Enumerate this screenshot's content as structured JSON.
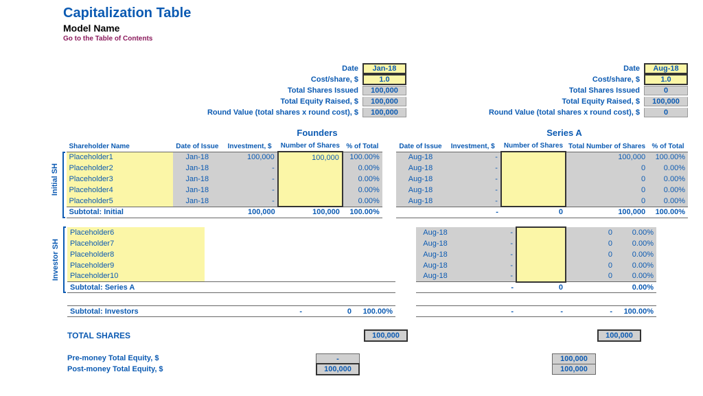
{
  "header": {
    "title": "Capitalization Table",
    "subtitle": "Model Name",
    "toc_link": "Go to the Table of Contents"
  },
  "summary": {
    "labels": {
      "date": "Date",
      "cost": "Cost/share, $",
      "shares": "Total Shares Issued",
      "equity": "Total Equity Raised, $",
      "round": "Round Value (total shares x round cost), $"
    },
    "founders": {
      "date": "Jan-18",
      "cost": "1.0",
      "shares": "100,000",
      "equity": "100,000",
      "round": "100,000"
    },
    "seriesA": {
      "date": "Aug-18",
      "cost": "1.0",
      "shares": "0",
      "equity": "100,000",
      "round": "0"
    }
  },
  "rounds": {
    "founders": "Founders",
    "seriesA": "Series A"
  },
  "cols": {
    "shareholder": "Shareholder Name",
    "date": "Date of Issue",
    "inv": "Investment, $",
    "num": "Number of Shares",
    "pct": "% of Total",
    "tot_num": "Total Number of Shares"
  },
  "groups": {
    "initial": "Initial SH",
    "investor": "Investor SH"
  },
  "initial_rows": [
    {
      "name": "Placeholder1",
      "fd": "Jan-18",
      "finv": "100,000",
      "fnum": "100,000",
      "fpct": "100.00%",
      "sd": "Aug-18",
      "sinv": "-",
      "snum": "",
      "stot": "100,000",
      "spct": "100.00%"
    },
    {
      "name": "Placeholder2",
      "fd": "Jan-18",
      "finv": "-",
      "fnum": "",
      "fpct": "0.00%",
      "sd": "Aug-18",
      "sinv": "-",
      "snum": "",
      "stot": "0",
      "spct": "0.00%"
    },
    {
      "name": "Placeholder3",
      "fd": "Jan-18",
      "finv": "-",
      "fnum": "",
      "fpct": "0.00%",
      "sd": "Aug-18",
      "sinv": "-",
      "snum": "",
      "stot": "0",
      "spct": "0.00%"
    },
    {
      "name": "Placeholder4",
      "fd": "Jan-18",
      "finv": "-",
      "fnum": "",
      "fpct": "0.00%",
      "sd": "Aug-18",
      "sinv": "-",
      "snum": "",
      "stot": "0",
      "spct": "0.00%"
    },
    {
      "name": "Placeholder5",
      "fd": "Jan-18",
      "finv": "-",
      "fnum": "",
      "fpct": "0.00%",
      "sd": "Aug-18",
      "sinv": "-",
      "snum": "",
      "stot": "0",
      "spct": "0.00%"
    }
  ],
  "subtotal_initial": {
    "label": "Subtotal: Initial",
    "finv": "100,000",
    "fnum": "100,000",
    "fpct": "100.00%",
    "sinv": "-",
    "snum": "0",
    "stot": "100,000",
    "spct": "100.00%"
  },
  "investor_rows": [
    {
      "name": "Placeholder6",
      "sd": "Aug-18",
      "sinv": "-",
      "snum": "",
      "stot": "0",
      "spct": "0.00%"
    },
    {
      "name": "Placeholder7",
      "sd": "Aug-18",
      "sinv": "-",
      "snum": "",
      "stot": "0",
      "spct": "0.00%"
    },
    {
      "name": "Placeholder8",
      "sd": "Aug-18",
      "sinv": "-",
      "snum": "",
      "stot": "0",
      "spct": "0.00%"
    },
    {
      "name": "Placeholder9",
      "sd": "Aug-18",
      "sinv": "-",
      "snum": "",
      "stot": "0",
      "spct": "0.00%"
    },
    {
      "name": "Placeholder10",
      "sd": "Aug-18",
      "sinv": "-",
      "snum": "",
      "stot": "0",
      "spct": "0.00%"
    }
  ],
  "subtotal_seriesA": {
    "label": "Subtotal: Series A",
    "sinv": "-",
    "snum": "0",
    "stot": "",
    "spct": "0.00%"
  },
  "subtotal_investors": {
    "label": "Subtotal: Investors",
    "finv": "-",
    "fnum": "0",
    "fpct": "100.00%",
    "sinv": "-",
    "snum": "-",
    "stot": "-",
    "spct": "100.00%"
  },
  "totals": {
    "total_shares_label": "TOTAL SHARES",
    "total_shares_f": "100,000",
    "total_shares_s": "100,000",
    "pre_label": "Pre-money Total Equity, $",
    "post_label": "Post-money Total Equity, $",
    "pre_f": "-",
    "post_f": "100,000",
    "pre_s": "100,000",
    "post_s": "100,000"
  }
}
